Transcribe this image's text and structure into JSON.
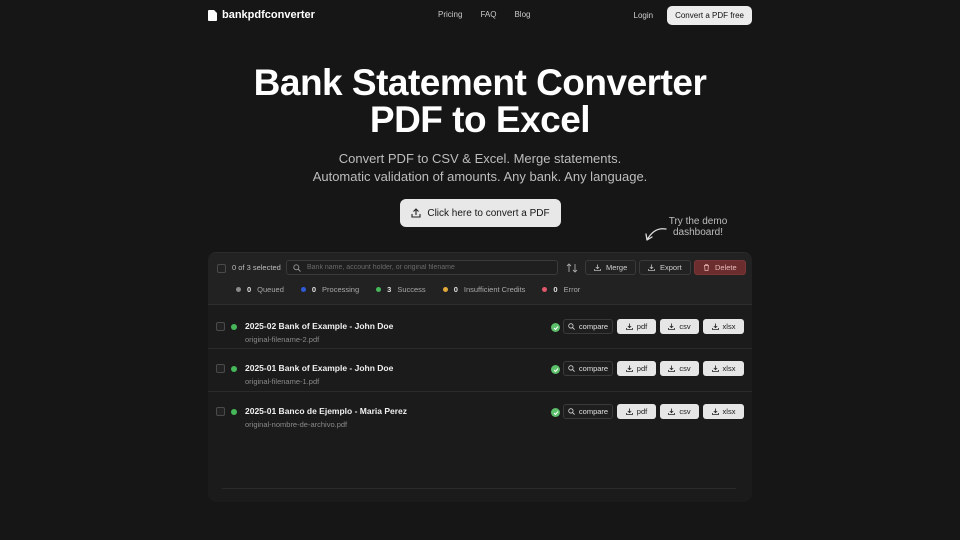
{
  "nav": {
    "brand": "bankpdfconverter",
    "links": [
      "Pricing",
      "FAQ",
      "Blog"
    ],
    "login": "Login",
    "cta": "Convert a PDF free"
  },
  "hero": {
    "title_line1": "Bank Statement Converter",
    "title_line2": "PDF to Excel",
    "subtitle_line1": "Convert PDF to CSV & Excel. Merge statements.",
    "subtitle_line2": "Automatic validation of amounts. Any bank. Any language.",
    "cta": "Click here to convert a PDF",
    "demo_note_line1": "Try the demo",
    "demo_note_line2": "dashboard!"
  },
  "toolbar": {
    "selection": "0 of 3 selected",
    "search_placeholder": "Bank name, account holder, or original filename",
    "merge": "Merge",
    "export": "Export",
    "delete": "Delete"
  },
  "statuses": [
    {
      "count": "0",
      "label": "Queued",
      "color": "#8a8a8a"
    },
    {
      "count": "0",
      "label": "Processing",
      "color": "#2e5bd6"
    },
    {
      "count": "3",
      "label": "Success",
      "color": "#47b85a"
    },
    {
      "count": "0",
      "label": "Insufficient Credits",
      "color": "#e0a93a"
    },
    {
      "count": "0",
      "label": "Error",
      "color": "#e0566b"
    }
  ],
  "rows": [
    {
      "name": "2025-02 Bank of Example - John Doe",
      "file": "original-filename-2.pdf"
    },
    {
      "name": "2025-01 Bank of Example - John Doe",
      "file": "original-filename-1.pdf"
    },
    {
      "name": "2025-01 Banco de Ejemplo - Maria Perez",
      "file": "original-nombre-de-archivo.pdf"
    }
  ],
  "row_actions": {
    "compare": "compare",
    "pdf": "pdf",
    "csv": "csv",
    "xlsx": "xlsx"
  }
}
